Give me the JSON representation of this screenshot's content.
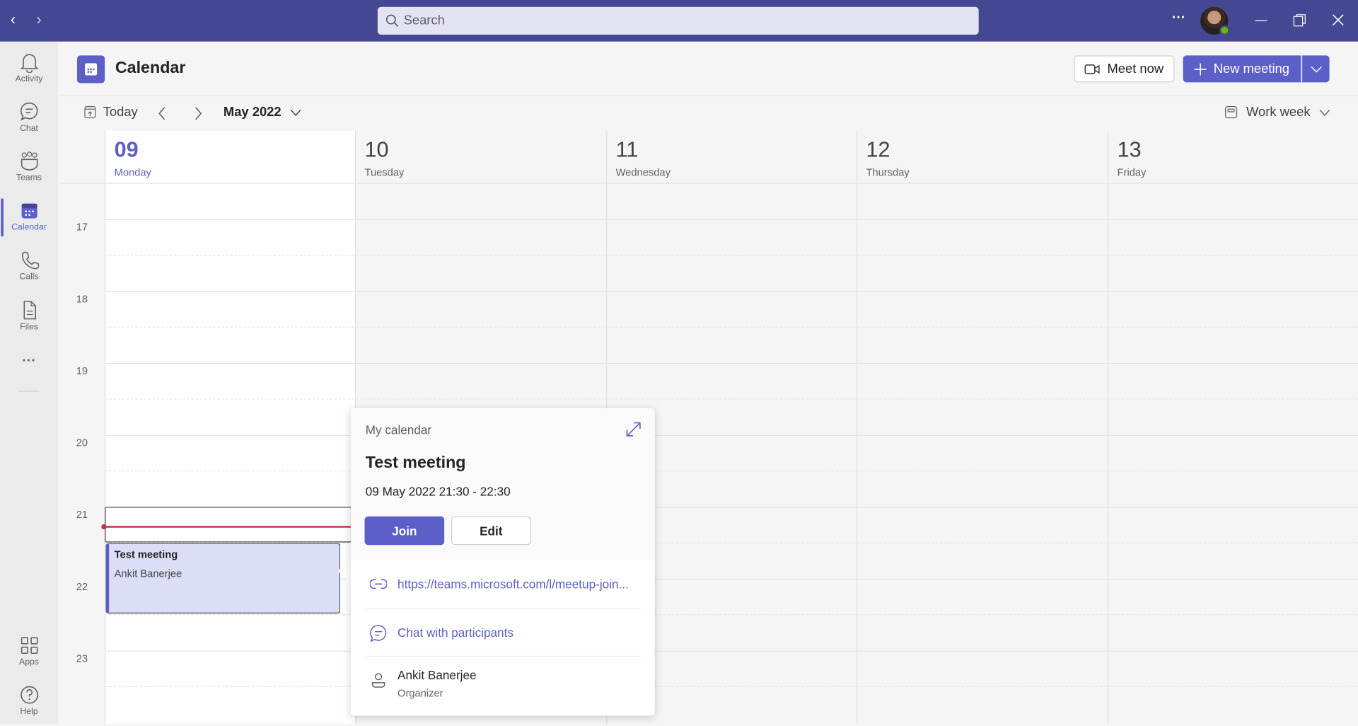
{
  "topbar": {
    "search_placeholder": "Search",
    "more_label": "···"
  },
  "rail": {
    "items": [
      {
        "label": "Activity",
        "icon": "bell-icon"
      },
      {
        "label": "Chat",
        "icon": "chat-icon"
      },
      {
        "label": "Teams",
        "icon": "teams-icon"
      },
      {
        "label": "Calendar",
        "icon": "calendar-icon",
        "active": true
      },
      {
        "label": "Calls",
        "icon": "phone-icon"
      },
      {
        "label": "Files",
        "icon": "file-icon"
      }
    ],
    "more": "···",
    "apps": "Apps",
    "help": "Help"
  },
  "header": {
    "title": "Calendar",
    "meet_now": "Meet now",
    "new_meeting": "New meeting"
  },
  "toolbar": {
    "today": "Today",
    "month": "May 2022",
    "view": "Work week"
  },
  "days": [
    {
      "num": "09",
      "name": "Monday",
      "today": true
    },
    {
      "num": "10",
      "name": "Tuesday"
    },
    {
      "num": "11",
      "name": "Wednesday"
    },
    {
      "num": "12",
      "name": "Thursday"
    },
    {
      "num": "13",
      "name": "Friday"
    }
  ],
  "hours": [
    "17",
    "18",
    "19",
    "20",
    "21",
    "22",
    "23"
  ],
  "event": {
    "title": "Test meeting",
    "organizer": "Ankit Banerjee"
  },
  "popup": {
    "calendar": "My calendar",
    "title": "Test meeting",
    "datetime": "09 May 2022 21:30 - 22:30",
    "join": "Join",
    "edit": "Edit",
    "link": "https://teams.microsoft.com/l/meetup-join...",
    "chat": "Chat with participants",
    "organizer_name": "Ankit Banerjee",
    "organizer_role": "Organizer"
  },
  "colors": {
    "brand": "#5b5fc7",
    "topbar": "#444791",
    "now_line": "#c4314b"
  }
}
